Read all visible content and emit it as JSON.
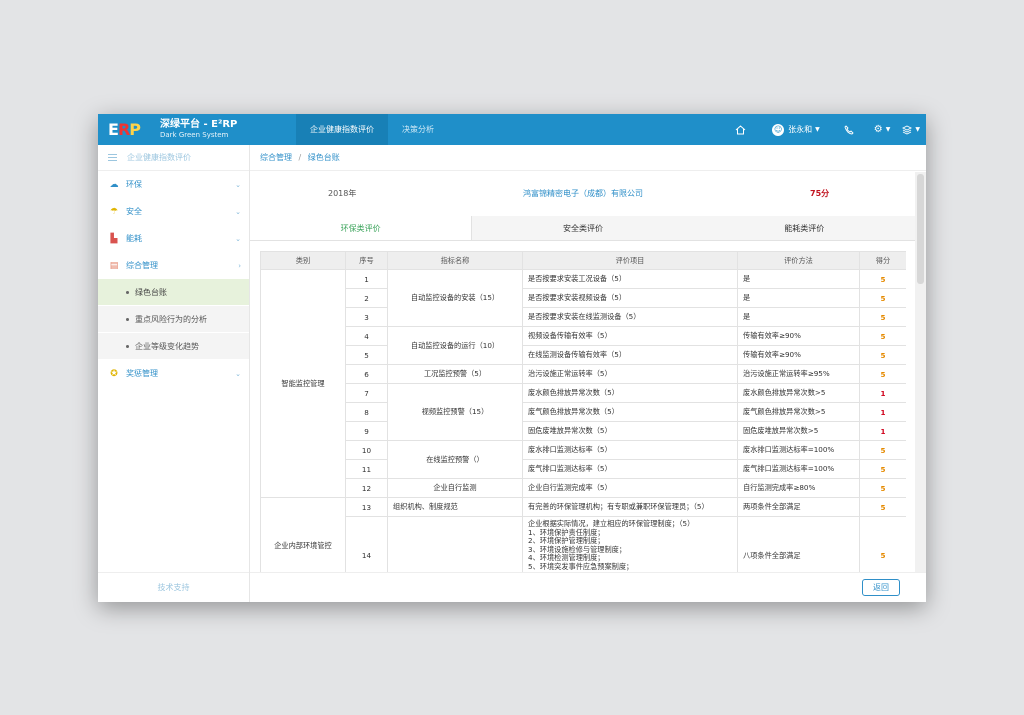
{
  "app": {
    "brand_title": "深绿平台 - E²RP",
    "brand_subtitle": "Dark Green System",
    "logo_letters": [
      "E",
      "R",
      "P"
    ]
  },
  "topnav": {
    "tabs": [
      {
        "label": "企业健康指数评价",
        "active": true
      },
      {
        "label": "决策分析",
        "active": false
      }
    ]
  },
  "user": {
    "name": "张永和"
  },
  "icons": {
    "home": "home-icon",
    "avatar": "user-icon",
    "phone": "phone-icon",
    "settings": "gear-icon",
    "layers": "layers-icon"
  },
  "sidebar": {
    "header": "企业健康指数评价",
    "items": [
      {
        "label": "环保",
        "icon": "cloud-icon",
        "chev": "⌄"
      },
      {
        "label": "安全",
        "icon": "umbrella-icon",
        "chev": "⌄"
      },
      {
        "label": "能耗",
        "icon": "chart-icon",
        "chev": "⌄"
      },
      {
        "label": "综合管理",
        "icon": "clipboard-icon",
        "chev": "›"
      }
    ],
    "subitems": [
      {
        "label": "绿色台账",
        "active": true
      },
      {
        "label": "重点风险行为的分析",
        "active": false
      },
      {
        "label": "企业等级变化趋势",
        "active": false
      }
    ],
    "last_item": {
      "label": "奖惩管理",
      "icon": "award-icon",
      "chev": "⌄"
    },
    "footer": "技术支持"
  },
  "breadcrumb": {
    "root": "综合管理",
    "sep": "/",
    "current": "绿色台账"
  },
  "summary": {
    "year": "2018年",
    "company": "鸿富锦精密电子（成都）有限公司",
    "score": "75分"
  },
  "subtabs": [
    {
      "label": "环保类评价",
      "active": true
    },
    {
      "label": "安全类评价",
      "active": false
    },
    {
      "label": "能耗类评价",
      "active": false
    }
  ],
  "table": {
    "headers": [
      "类别",
      "序号",
      "指标名称",
      "评价项目",
      "评价方法",
      "得分"
    ],
    "categories": [
      "智能监控管理",
      "企业内部环境管控"
    ],
    "indicators": [
      "自动监控设备的安装（15）",
      "自动监控设备的运行（10）",
      "工况监控预警（5）",
      "视频监控预警（15）",
      "在线监控预警（）",
      "企业自行监测",
      "组织机构、制度规范"
    ],
    "rows": [
      {
        "no": "1",
        "item": "是否按要求安装工况设备（5）",
        "method": "是",
        "score": "5"
      },
      {
        "no": "2",
        "item": "是否按要求安装视频设备（5）",
        "method": "是",
        "score": "5"
      },
      {
        "no": "3",
        "item": "是否按要求安装在线监测设备（5）",
        "method": "是",
        "score": "5"
      },
      {
        "no": "4",
        "item": "视频设备传输有效率（5）",
        "method": "传输有效率≥90%",
        "score": "5"
      },
      {
        "no": "5",
        "item": "在线监测设备传输有效率（5）",
        "method": "传输有效率≥90%",
        "score": "5"
      },
      {
        "no": "6",
        "item": "治污设施正常运转率（5）",
        "method": "治污设施正常运转率≥95%",
        "score": "5"
      },
      {
        "no": "7",
        "item": "废水颜色排放异常次数（5）",
        "method": "废水颜色排放异常次数>5",
        "score": "1"
      },
      {
        "no": "8",
        "item": "废气颜色排放异常次数（5）",
        "method": "废气颜色排放异常次数>5",
        "score": "1"
      },
      {
        "no": "9",
        "item": "固危废堆放异常次数（5）",
        "method": "固危废堆放异常次数>5",
        "score": "1"
      },
      {
        "no": "10",
        "item": "废水排口监测达标率（5）",
        "method": "废水排口监测达标率=100%",
        "score": "5"
      },
      {
        "no": "11",
        "item": "废气排口监测达标率（5）",
        "method": "废气排口监测达标率=100%",
        "score": "5"
      },
      {
        "no": "12",
        "item": "企业自行监测完成率（5）",
        "method": "自行监测完成率≥80%",
        "score": "5"
      },
      {
        "no": "13",
        "item": "有完善的环保管理机构；有专职或兼职环保管理员；（5）",
        "method": "两项条件全部满足",
        "score": "5"
      },
      {
        "no": "14",
        "item": "企业根据实际情况，建立相应的环保管理制度；（5）",
        "method": "八项条件全部满足",
        "score": "5"
      }
    ],
    "row14_lines": [
      "1、环境保护责任制度；",
      "2、环境保护管理制度；",
      "3、环境设施检修与管理制度；",
      "4、环境检测管理制度；",
      "5、环境突发事件应急预案制度；"
    ]
  },
  "actions": {
    "back": "返回"
  },
  "colors": {
    "primary": "#1f8fc9",
    "score_red": "#c1121f",
    "score_orange": "#e58a00",
    "active_tab_green": "#3aa35a"
  }
}
